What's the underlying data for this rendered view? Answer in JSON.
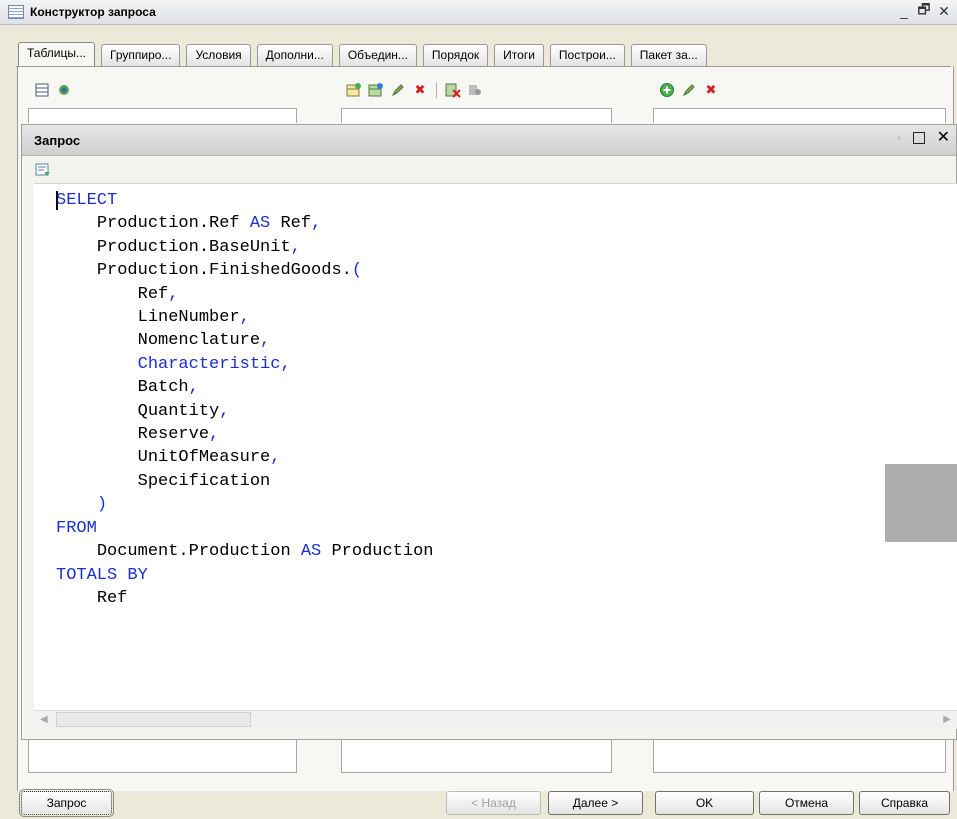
{
  "window": {
    "title": "Конструктор запроса",
    "minimize_glyph": "_",
    "restore_glyph": "🗗",
    "close_glyph": "✕"
  },
  "tabs": [
    {
      "label": "Таблицы..."
    },
    {
      "label": "Группиро..."
    },
    {
      "label": "Условия"
    },
    {
      "label": "Дополни..."
    },
    {
      "label": "Объедин..."
    },
    {
      "label": "Порядок"
    },
    {
      "label": "Итоги"
    },
    {
      "label": "Построи..."
    },
    {
      "label": "Пакет за..."
    }
  ],
  "query_window": {
    "title": "Запрос",
    "code": [
      {
        "indent": 0,
        "parts": [
          {
            "text": "SELECT",
            "kw": true
          }
        ]
      },
      {
        "indent": 1,
        "parts": [
          {
            "text": "Production.Ref "
          },
          {
            "text": "AS",
            "kw": true
          },
          {
            "text": " Ref"
          },
          {
            "text": ",",
            "kw": true
          }
        ]
      },
      {
        "indent": 1,
        "parts": [
          {
            "text": "Production.BaseUnit"
          },
          {
            "text": ",",
            "kw": true
          }
        ]
      },
      {
        "indent": 1,
        "parts": [
          {
            "text": "Production.FinishedGoods."
          },
          {
            "text": "(",
            "kw": true
          }
        ]
      },
      {
        "indent": 2,
        "parts": [
          {
            "text": "Ref"
          },
          {
            "text": ",",
            "kw": true
          }
        ]
      },
      {
        "indent": 2,
        "parts": [
          {
            "text": "LineNumber"
          },
          {
            "text": ",",
            "kw": true
          }
        ]
      },
      {
        "indent": 2,
        "parts": [
          {
            "text": "Nomenclature"
          },
          {
            "text": ",",
            "kw": true
          }
        ]
      },
      {
        "indent": 2,
        "parts": [
          {
            "text": "Characteristic,",
            "kw": true
          }
        ]
      },
      {
        "indent": 2,
        "parts": [
          {
            "text": "Batch"
          },
          {
            "text": ",",
            "kw": true
          }
        ]
      },
      {
        "indent": 2,
        "parts": [
          {
            "text": "Quantity"
          },
          {
            "text": ",",
            "kw": true
          }
        ]
      },
      {
        "indent": 2,
        "parts": [
          {
            "text": "Reserve"
          },
          {
            "text": ",",
            "kw": true
          }
        ]
      },
      {
        "indent": 2,
        "parts": [
          {
            "text": "UnitOfMeasure"
          },
          {
            "text": ",",
            "kw": true
          }
        ]
      },
      {
        "indent": 2,
        "parts": [
          {
            "text": "Specification"
          }
        ]
      },
      {
        "indent": 1,
        "parts": [
          {
            "text": ")",
            "kw": true
          }
        ]
      },
      {
        "indent": 0,
        "parts": [
          {
            "text": "FROM",
            "kw": true
          }
        ]
      },
      {
        "indent": 1,
        "parts": [
          {
            "text": "Document.Production "
          },
          {
            "text": "AS",
            "kw": true
          },
          {
            "text": " Production"
          }
        ]
      },
      {
        "indent": 0,
        "parts": [
          {
            "text": "TOTALS BY",
            "kw": true
          }
        ]
      },
      {
        "indent": 1,
        "parts": [
          {
            "text": "Ref"
          }
        ]
      }
    ]
  },
  "buttons": {
    "query": "Запрос",
    "back": "< Назад",
    "next": "Далее >",
    "ok": "OK",
    "cancel": "Отмена",
    "help": "Справка"
  },
  "colors": {
    "keyword": "#1a2fd0",
    "title_bar": "#dfe0e6",
    "gray_block": "#adadad"
  },
  "icons": [
    "table-icon",
    "wizard-icon",
    "add-table-icon",
    "add-field-icon",
    "edit-icon",
    "delete-icon",
    "delete-all-icon",
    "settings-icon",
    "add-green-icon",
    "edit-icon",
    "delete-icon",
    "query-text-icon"
  ]
}
